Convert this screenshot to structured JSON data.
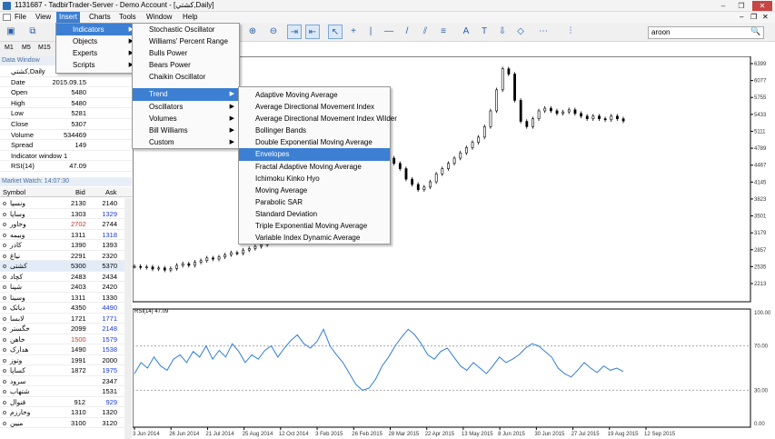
{
  "window": {
    "title": "1131687 - TadbirTrader-Server - Demo Account - [كشتي,Daily]",
    "minimize": "–",
    "restore": "❐",
    "close": "✕"
  },
  "menubar": {
    "items": [
      "File",
      "View",
      "Insert",
      "Charts",
      "Tools",
      "Window",
      "Help"
    ],
    "active": "Insert",
    "doc_minimize": "–",
    "doc_restore": "❐",
    "doc_close": "✕"
  },
  "toolbar": {
    "search_value": "aroon",
    "search_icon": "search-icon"
  },
  "timeframes": [
    "M1",
    "M5",
    "M15"
  ],
  "data_window": {
    "title": "Data Window",
    "symbol_row": "كشتي,Daily",
    "rows": [
      [
        "Date",
        "2015.09.15"
      ],
      [
        "Open",
        "5480"
      ],
      [
        "High",
        "5480"
      ],
      [
        "Low",
        "5281"
      ],
      [
        "Close",
        "5307"
      ],
      [
        "Volume",
        "534469"
      ],
      [
        "Spread",
        "149"
      ]
    ],
    "indicator_window": "Indicator window 1",
    "rsi": [
      "RSI(14)",
      "47.09"
    ]
  },
  "market_watch": {
    "title": "Market Watch: 14:07:30",
    "headers": [
      "Symbol",
      "Bid",
      "Ask"
    ],
    "rows": [
      [
        "ونسپا",
        "2130",
        "2140"
      ],
      [
        "وساپا",
        "1303",
        "1329"
      ],
      [
        "وخاور",
        "2702",
        "2744"
      ],
      [
        "وبیمه",
        "1311",
        "1318"
      ],
      [
        "کاذر",
        "1390",
        "1393"
      ],
      [
        "نیاغ",
        "2291",
        "2320"
      ],
      [
        "کشتی",
        "5300",
        "5370"
      ],
      [
        "کچاد",
        "2483",
        "2434"
      ],
      [
        "شپنا",
        "2403",
        "2420"
      ],
      [
        "وسینا",
        "1311",
        "1330"
      ],
      [
        "دیاتک",
        "4350",
        "4490"
      ],
      [
        "لابسا",
        "1721",
        "1771"
      ],
      [
        "خگستر",
        "2099",
        "2148"
      ],
      [
        "خاهن",
        "1500",
        "1579"
      ],
      [
        "هدارک",
        "1490",
        "1538"
      ],
      [
        "وتوز",
        "1991",
        "2000"
      ],
      [
        "کساپا",
        "1872",
        "1975"
      ],
      [
        "سرود",
        "",
        "2347"
      ],
      [
        "شتهاب",
        "",
        "1531"
      ],
      [
        "قنوال",
        "912",
        "929"
      ],
      [
        "وخارزم",
        "1310",
        "1320"
      ],
      [
        "میین",
        "3100",
        "3120"
      ]
    ],
    "bid_colors": [
      "#000",
      "#000",
      "#c0392b",
      "#000",
      "#000",
      "#000",
      "#000",
      "#000",
      "#000",
      "#000",
      "#000",
      "#000",
      "#000",
      "#c0392b",
      "#000",
      "#000",
      "#000",
      "#000",
      "#000",
      "#000",
      "#000",
      "#000"
    ],
    "ask_colors": [
      "#000",
      "#1a3ad6",
      "#000",
      "#1a3ad6",
      "#000",
      "#000",
      "#000",
      "#000",
      "#000",
      "#000",
      "#1a3ad6",
      "#1a3ad6",
      "#1a3ad6",
      "#1a3ad6",
      "#1a3ad6",
      "#000",
      "#1a3ad6",
      "#000",
      "#000",
      "#1a3ad6",
      "#000",
      "#000"
    ]
  },
  "insert_menu": [
    "Indicators",
    "Objects",
    "Experts",
    "Scripts"
  ],
  "indicators_menu": [
    "Stochastic Oscillator",
    "Williams' Percent Range",
    "Bulls Power",
    "Bears Power",
    "Chaikin Oscillator",
    "Trend",
    "Oscillators",
    "Volumes",
    "Bill Williams",
    "Custom"
  ],
  "trend_menu": [
    "Adaptive Moving Average",
    "Average Directional Movement Index",
    "Average Directional Movement Index Wilder",
    "Bollinger Bands",
    "Double Exponential Moving Average",
    "Envelopes",
    "Fractal Adaptive Moving Average",
    "Ichimoku Kinko Hyo",
    "Moving Average",
    "Parabolic SAR",
    "Standard Deviation",
    "Triple Exponential Moving Average",
    "Variable Index Dynamic Average"
  ],
  "highlighted": {
    "insert": "Indicators",
    "indicators": "Trend",
    "trend": "Envelopes"
  },
  "chart": {
    "price_ticks": [
      "6399",
      "6077",
      "5755",
      "5433",
      "5111",
      "4789",
      "4467",
      "4145",
      "3823",
      "3501",
      "3179",
      "2857",
      "2535",
      "2213"
    ],
    "time_ticks": [
      "3 Jun 2014",
      "26 Jun 2014",
      "21 Jul 2014",
      "25 Aug 2014",
      "12 Oct 2014",
      "3 Feb 2015",
      "26 Feb 2015",
      "28 Mar 2015",
      "22 Apr 2015",
      "13 May 2015",
      "8 Jun 2015",
      "30 Jun 2015",
      "27 Jul 2015",
      "19 Aug 2015",
      "12 Sep 2015"
    ],
    "rsi_label": "RSI(14) 47.09",
    "rsi_levels": [
      "100.00",
      "70.00",
      "30.00",
      "0.00"
    ],
    "price_series": [
      2540,
      2520,
      2530,
      2490,
      2510,
      2470,
      2500,
      2560,
      2590,
      2560,
      2620,
      2650,
      2700,
      2680,
      2720,
      2760,
      2800,
      2790,
      2850,
      2880,
      2920,
      2950,
      3000,
      3050,
      3100,
      3200,
      3300,
      3400,
      3500,
      3600,
      3700,
      3800,
      3900,
      4000,
      4150,
      4300,
      4400,
      4500,
      4600,
      4600,
      4650,
      4700,
      4600,
      4500,
      4400,
      4200,
      4100,
      4000,
      4050,
      4150,
      4300,
      4400,
      4500,
      4600,
      4700,
      4800,
      4900,
      5000,
      5200,
      5500,
      5900,
      6300,
      6200,
      5700,
      5300,
      5200,
      5350,
      5500,
      5550,
      5500,
      5450,
      5480,
      5520,
      5450,
      5400,
      5350,
      5400,
      5350,
      5330,
      5400,
      5350,
      5307
    ],
    "rsi_series": [
      45,
      55,
      50,
      60,
      52,
      48,
      58,
      62,
      55,
      65,
      60,
      70,
      58,
      66,
      60,
      72,
      65,
      55,
      62,
      58,
      66,
      70,
      60,
      68,
      75,
      80,
      72,
      68,
      74,
      85,
      70,
      62,
      55,
      45,
      35,
      30,
      32,
      40,
      52,
      60,
      70,
      78,
      85,
      80,
      72,
      62,
      58,
      65,
      68,
      60,
      52,
      48,
      55,
      50,
      45,
      52,
      60,
      55,
      58,
      62,
      68,
      72,
      70,
      65,
      60,
      50,
      45,
      42,
      48,
      55,
      50,
      46,
      52,
      48,
      50,
      47
    ]
  }
}
